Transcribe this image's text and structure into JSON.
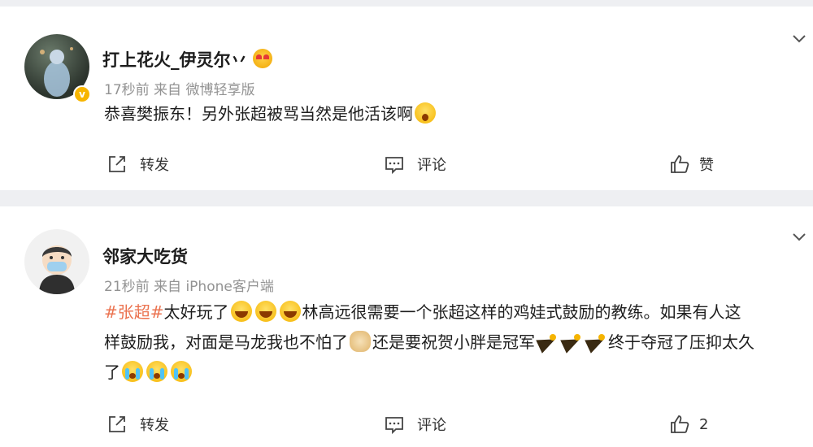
{
  "colors": {
    "topic": "#eb7350",
    "verified_badge": "#f7b500",
    "background": "#eeeff2"
  },
  "posts": [
    {
      "user_name": "打上花火_伊灵尔丷",
      "name_emoji": "heart-eyes-emoji",
      "time": "17秒前",
      "source": "来自 微博轻享版",
      "text_1": "恭喜樊振东！另外张超被骂当然是他活该啊",
      "emoji_1": "shocked-emoji",
      "repost_label": "转发",
      "comment_label": "评论",
      "like_label": "赞"
    },
    {
      "user_name": "邻家大吃货",
      "time": "21秒前",
      "source": "来自 iPhone客户端",
      "topic": "#张超#",
      "text_1": "太好玩了",
      "text_2": "林高远很需要一个张超这样的鸡娃式鼓励的教练。如果有人这样鼓励我，对面是马龙我也不怕了",
      "text_3": "还是要祝贺小胖是冠军",
      "text_4": "终于夺冠了压抑太久了",
      "repost_label": "转发",
      "comment_label": "评论",
      "like_count": "2"
    }
  ]
}
